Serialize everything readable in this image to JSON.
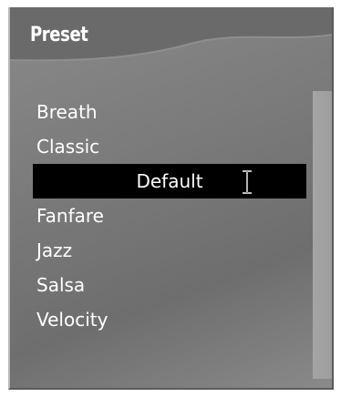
{
  "header": {
    "title": "Preset"
  },
  "preset_list": {
    "items": [
      {
        "label": "Breath",
        "selected": false
      },
      {
        "label": "Classic",
        "selected": false
      },
      {
        "label": "Default",
        "selected": true
      },
      {
        "label": "Fanfare",
        "selected": false
      },
      {
        "label": "Jazz",
        "selected": false
      },
      {
        "label": "Salsa",
        "selected": false
      },
      {
        "label": "Velocity",
        "selected": false
      }
    ]
  },
  "icons": {
    "text_cursor": "ibeam-cursor-icon"
  },
  "colors": {
    "panel_bg": "#7c7c7c",
    "header_band": "#6a6a6a",
    "selection_bg": "#000000",
    "text": "#ffffff",
    "scrollbar": "#9a9a9a"
  }
}
